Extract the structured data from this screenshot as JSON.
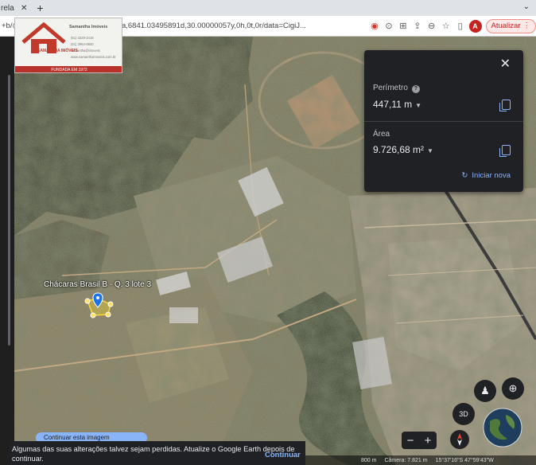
{
  "browser": {
    "tab_fragment": "rela",
    "url": "+b/@-15.6848744,-47.979.5278793a,6841.03495891d,30.00000057y,0h,0t,0r/data=CigiJ...",
    "update_label": "Atualizar",
    "avatar_letter": "A"
  },
  "logo": {
    "name": "Samantha Imóveis",
    "lines": [
      "(61) 3229-2416",
      "(61) 3964-8900",
      "samantha@imoveis",
      "www.samanthaimoveis.com.br"
    ],
    "brand": "SAMANTHA IMÓVEIS",
    "founded": "FUNDADA EM 1972"
  },
  "measure_panel": {
    "perimeter_label": "Perímetro",
    "perimeter_value": "447,11 m",
    "area_label": "Área",
    "area_value": "9.726,68 m²",
    "restart_label": "Iniciar nova"
  },
  "placemark": {
    "label": "Chácaras Brasil B - Q. 3 lote 3"
  },
  "notification": {
    "message": "Algumas das suas alterações talvez sejam perdidas. Atualize o Google Earth depois de continuar.",
    "action": "Continuar",
    "hidden_button": "Continuar esta imagem"
  },
  "status": {
    "scale": "800 m",
    "camera": "Câmera: 7.821 m",
    "coords": "15°37'16\"S 47°59'43\"W"
  },
  "controls": {
    "view_3d": "3D"
  },
  "colors": {
    "panel_bg": "#202124",
    "accent_blue": "#8ab4f8",
    "update_red": "#c5221f"
  }
}
